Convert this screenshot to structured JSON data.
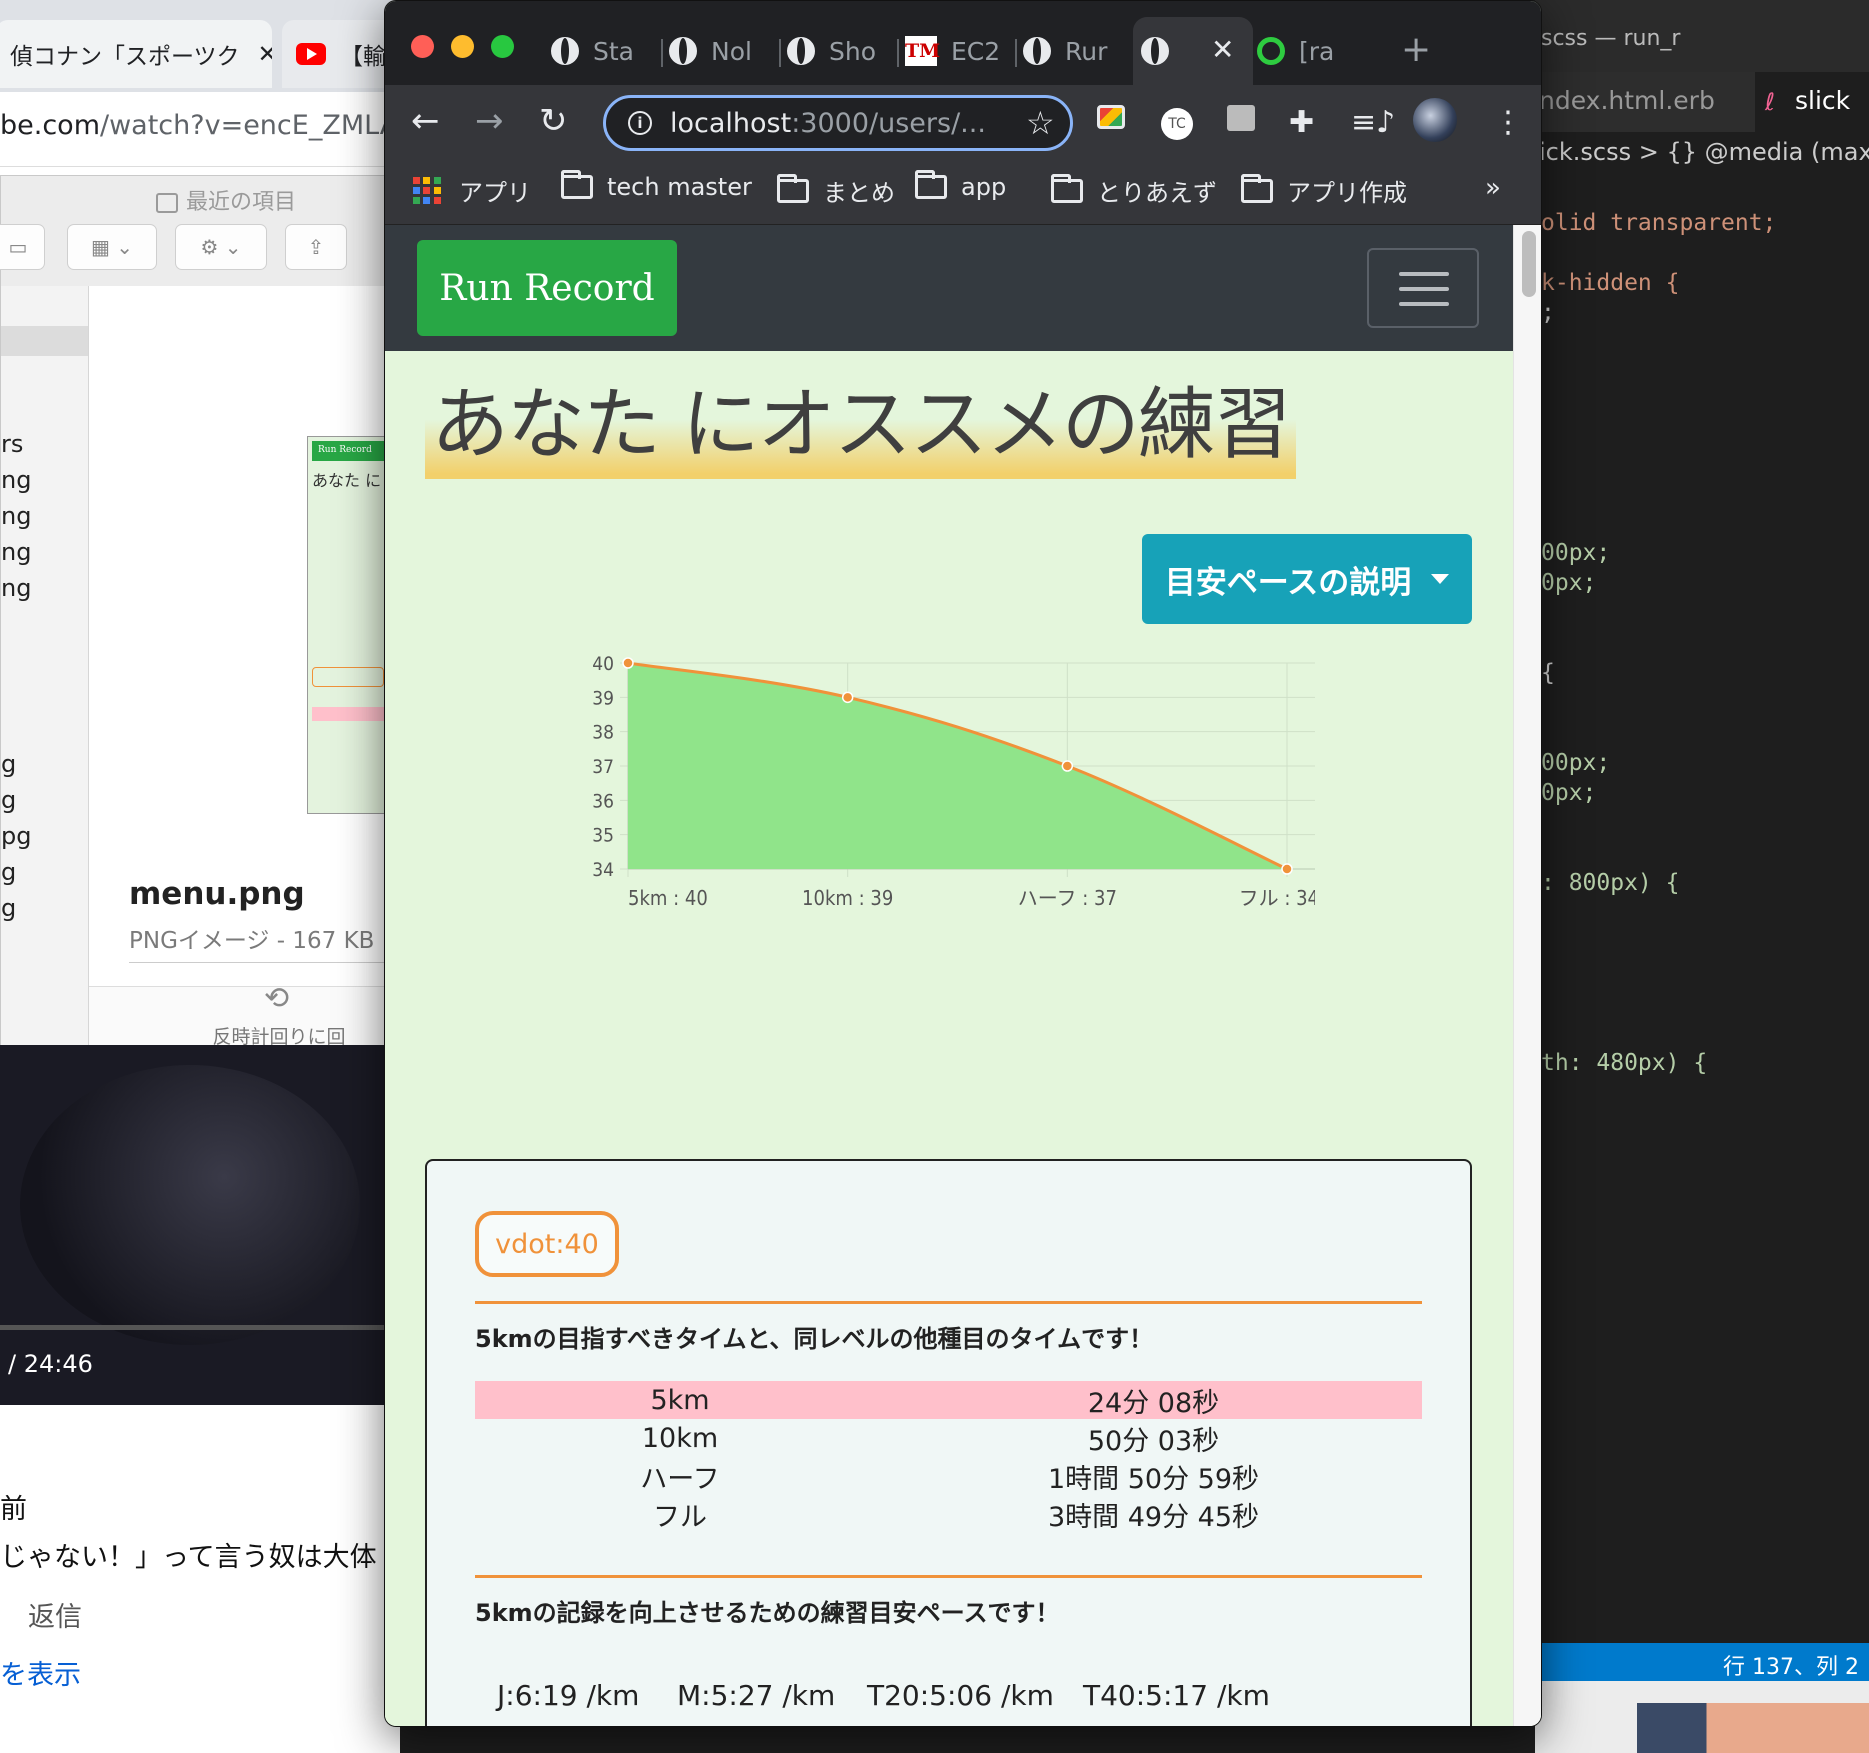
{
  "youtube": {
    "tab1_title": "偵コナン「スポーツク",
    "tab2_title": "【輸",
    "url_host": "be.com",
    "url_path": "/watch?v=encE_ZMLA",
    "video_time": "/ 24:46",
    "comment_frag1": "前",
    "comment_frag2": "じゃない！」って言う奴は大体",
    "reply_label": "返信",
    "show_more": "を表示"
  },
  "finder": {
    "title": "最近の項目",
    "sidebar_rows": [
      "rs",
      "ng",
      "ng",
      "ng",
      "ng"
    ],
    "sidebar_rows2": [
      "g",
      "g",
      "pg",
      "g",
      "g"
    ],
    "file_name": "menu.png",
    "file_meta": "PNGイメージ - 167 KB",
    "rotate_label": "反時計回りに回転",
    "thumb_button": "Run Record",
    "thumb_title": "あなた に"
  },
  "vscode": {
    "title": "scss — run_r",
    "tab1": "ndex.html.erb",
    "tab2": "slick",
    "breadcrumb": "ick.scss > {} @media (max-",
    "status": "行 137、列 2",
    "code_lines": [
      {
        "y": 210,
        "text": "olid transparent;"
      },
      {
        "y": 270,
        "text": "k-hidden {"
      },
      {
        "y": 300,
        "text": ";"
      },
      {
        "y": 540,
        "text": "00px;"
      },
      {
        "y": 570,
        "text": "0px;"
      },
      {
        "y": 660,
        "text": "{"
      },
      {
        "y": 750,
        "text": "00px;"
      },
      {
        "y": 780,
        "text": "0px;"
      },
      {
        "y": 870,
        "text": ": 800px) {"
      },
      {
        "y": 1050,
        "text": "th: 480px) {"
      }
    ]
  },
  "browser": {
    "tabs": [
      {
        "label": "Sta",
        "icon": "globe-icon"
      },
      {
        "label": "Nol",
        "icon": "globe-icon"
      },
      {
        "label": "Sho",
        "icon": "globe-icon"
      },
      {
        "label": "EC2",
        "icon": "tm-icon"
      },
      {
        "label": "Rur",
        "icon": "globe-icon"
      },
      {
        "label": "",
        "icon": "globe-icon"
      },
      {
        "label": "[ra",
        "icon": "green-circle-icon"
      }
    ],
    "url_host": "localhost",
    "url_rest": ":3000/users/...",
    "bookmarks": [
      "アプリ",
      "tech master",
      "まとめ",
      "app",
      "とりあえず",
      "アプリ作成"
    ],
    "more": "»"
  },
  "page": {
    "brand": "Run Record",
    "headline": "あなた にオススメの練習",
    "dropdown_label": "目安ペースの説明",
    "vdot_badge": "vdot:40",
    "times_heading": "5kmの目指すべきタイムと、同レベルの他種目のタイムです！",
    "times": [
      {
        "event": "5km",
        "time": "24分 08秒"
      },
      {
        "event": "10km",
        "time": "50分 03秒"
      },
      {
        "event": "ハーフ",
        "time": "1時間 50分 59秒"
      },
      {
        "event": "フル",
        "time": "3時間 49分 45秒"
      }
    ],
    "pace_heading": "5kmの記録を向上させるための練習目安ペースです！",
    "paces": [
      "J:6:19 /km",
      "M:5:27 /km",
      "T20:5:06 /km",
      "T40:5:17 /km"
    ]
  },
  "chart_data": {
    "type": "area",
    "categories": [
      "5km : 40",
      "10km : 39",
      "ハーフ : 37",
      "フル : 34"
    ],
    "values": [
      40,
      39,
      37,
      34
    ],
    "y_ticks": [
      34,
      35,
      36,
      37,
      38,
      39,
      40
    ],
    "ylim": [
      34,
      40
    ],
    "grid": true,
    "fill_color": "#90e48a",
    "line_color": "#f0923a",
    "point_color": "#f0923a"
  }
}
